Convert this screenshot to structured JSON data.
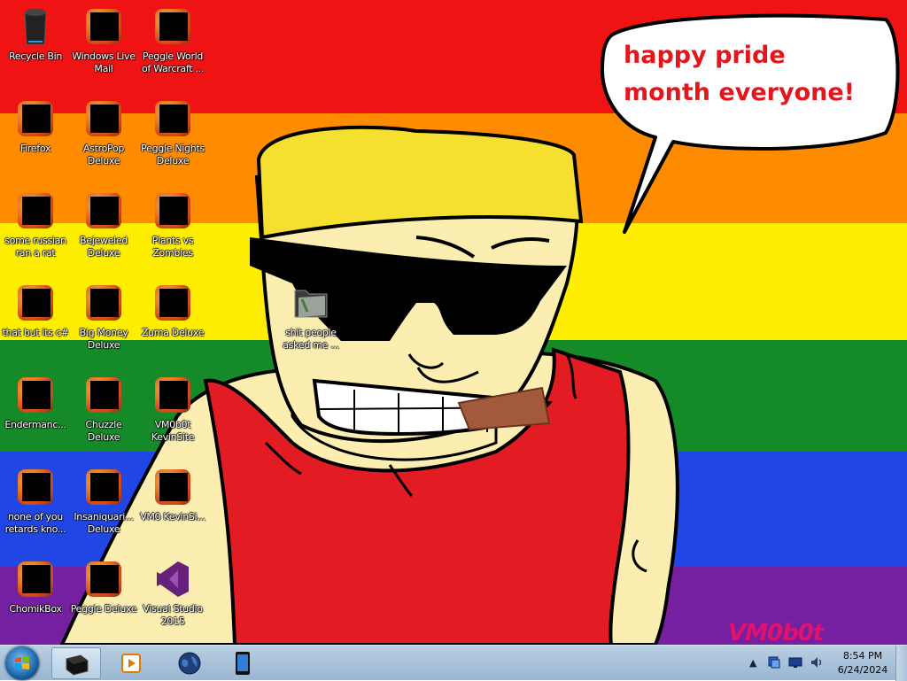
{
  "desktop": {
    "speech_bubble": "happy pride month everyone!",
    "watermark": "VM0b0t",
    "icons": [
      {
        "label": "Recycle Bin",
        "icon": "recycle-bin-icon",
        "censored": false
      },
      {
        "label": "Windows Live Mail",
        "icon": "mail-icon",
        "censored": true
      },
      {
        "label": "Peggle World of Warcraft ...",
        "icon": "peggle-icon",
        "censored": true
      },
      {
        "label": "Firefox",
        "icon": "firefox-icon",
        "censored": true
      },
      {
        "label": "AstroPop Deluxe",
        "icon": "astropop-icon",
        "censored": true
      },
      {
        "label": "Peggle Nights Deluxe",
        "icon": "peggle-nights-icon",
        "censored": true
      },
      {
        "label": "some russian ran a rat",
        "icon": "shortcut-icon",
        "censored": true
      },
      {
        "label": "Bejeweled Deluxe",
        "icon": "bejeweled-icon",
        "censored": true
      },
      {
        "label": "Plants vs Zombies",
        "icon": "plants-vs-zombies-icon",
        "censored": true
      },
      {
        "label": "that but its c#",
        "icon": "windows-icon",
        "censored": true
      },
      {
        "label": "Big Money Deluxe",
        "icon": "money-bag-icon",
        "censored": true
      },
      {
        "label": "Zuma Deluxe",
        "icon": "zuma-icon",
        "censored": true
      },
      {
        "label": "Endermanc...",
        "icon": "terminal-icon",
        "censored": true
      },
      {
        "label": "Chuzzle Deluxe",
        "icon": "chuzzle-icon",
        "censored": true
      },
      {
        "label": "VM0b0t KevinSite",
        "icon": "site-icon",
        "censored": true
      },
      {
        "label": "none of you retards kno...",
        "icon": "app-icon",
        "censored": true
      },
      {
        "label": "Insaniquari... Deluxe",
        "icon": "insaniquarium-icon",
        "censored": true
      },
      {
        "label": "VM0 KevinSi...",
        "icon": "site-icon",
        "censored": true
      },
      {
        "label": "ChomikBox",
        "icon": "chomikbox-icon",
        "censored": true
      },
      {
        "label": "Peggle Deluxe",
        "icon": "peggle-icon",
        "censored": true
      },
      {
        "label": "Visual Studio 2015",
        "icon": "visual-studio-icon",
        "censored": false
      },
      {
        "label": "shit people asked me ...",
        "icon": "folder-icon",
        "censored": false
      }
    ]
  },
  "taskbar": {
    "start": "start-orb-icon",
    "pinned": [
      "command-prompt-icon",
      "media-player-icon",
      "globe-icon",
      "tablet-icon"
    ],
    "tray_icons": [
      "network-icon",
      "display-icon",
      "volume-icon"
    ],
    "time": "8:54 PM",
    "date": "6/24/2024"
  },
  "colors": {
    "rainbow": [
      "#ef1313",
      "#ff8c00",
      "#ffee00",
      "#148a29",
      "#2046e6",
      "#7520a0"
    ],
    "skin": "#fbeeb0",
    "shirt": "#e31b23",
    "hat": "#f5e030",
    "cigar": "#a35a3c",
    "bubble_text": "#e3161b",
    "watermark": "#e0126e"
  }
}
